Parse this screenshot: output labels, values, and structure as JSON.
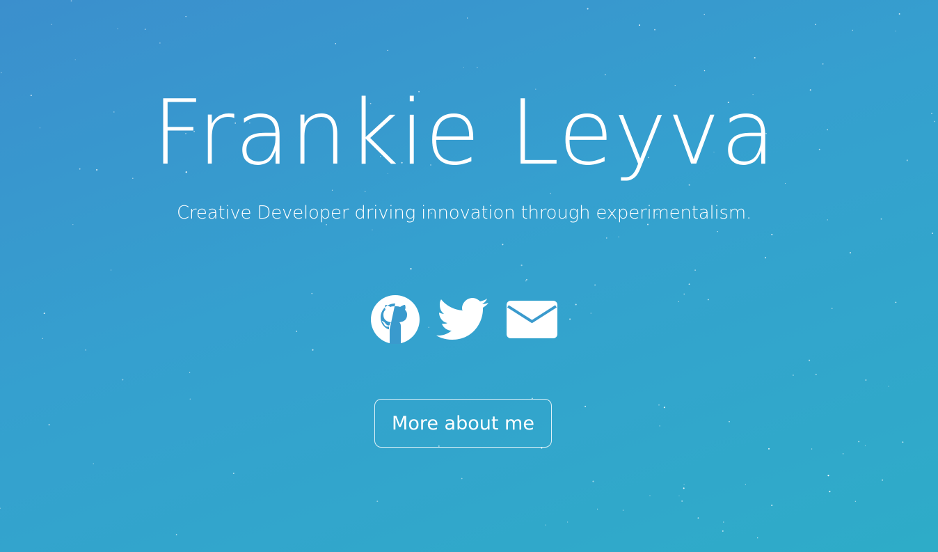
{
  "hero": {
    "name": "Frankie Leyva",
    "tagline": "Creative Developer driving innovation through experimentalism.",
    "cta_label": "More about me"
  },
  "socials": [
    {
      "icon": "github-icon"
    },
    {
      "icon": "twitter-icon"
    },
    {
      "icon": "email-icon"
    }
  ],
  "colors": {
    "background_start": "#3b8fcd",
    "background_end": "#2eacc8",
    "foreground": "#ffffff"
  }
}
